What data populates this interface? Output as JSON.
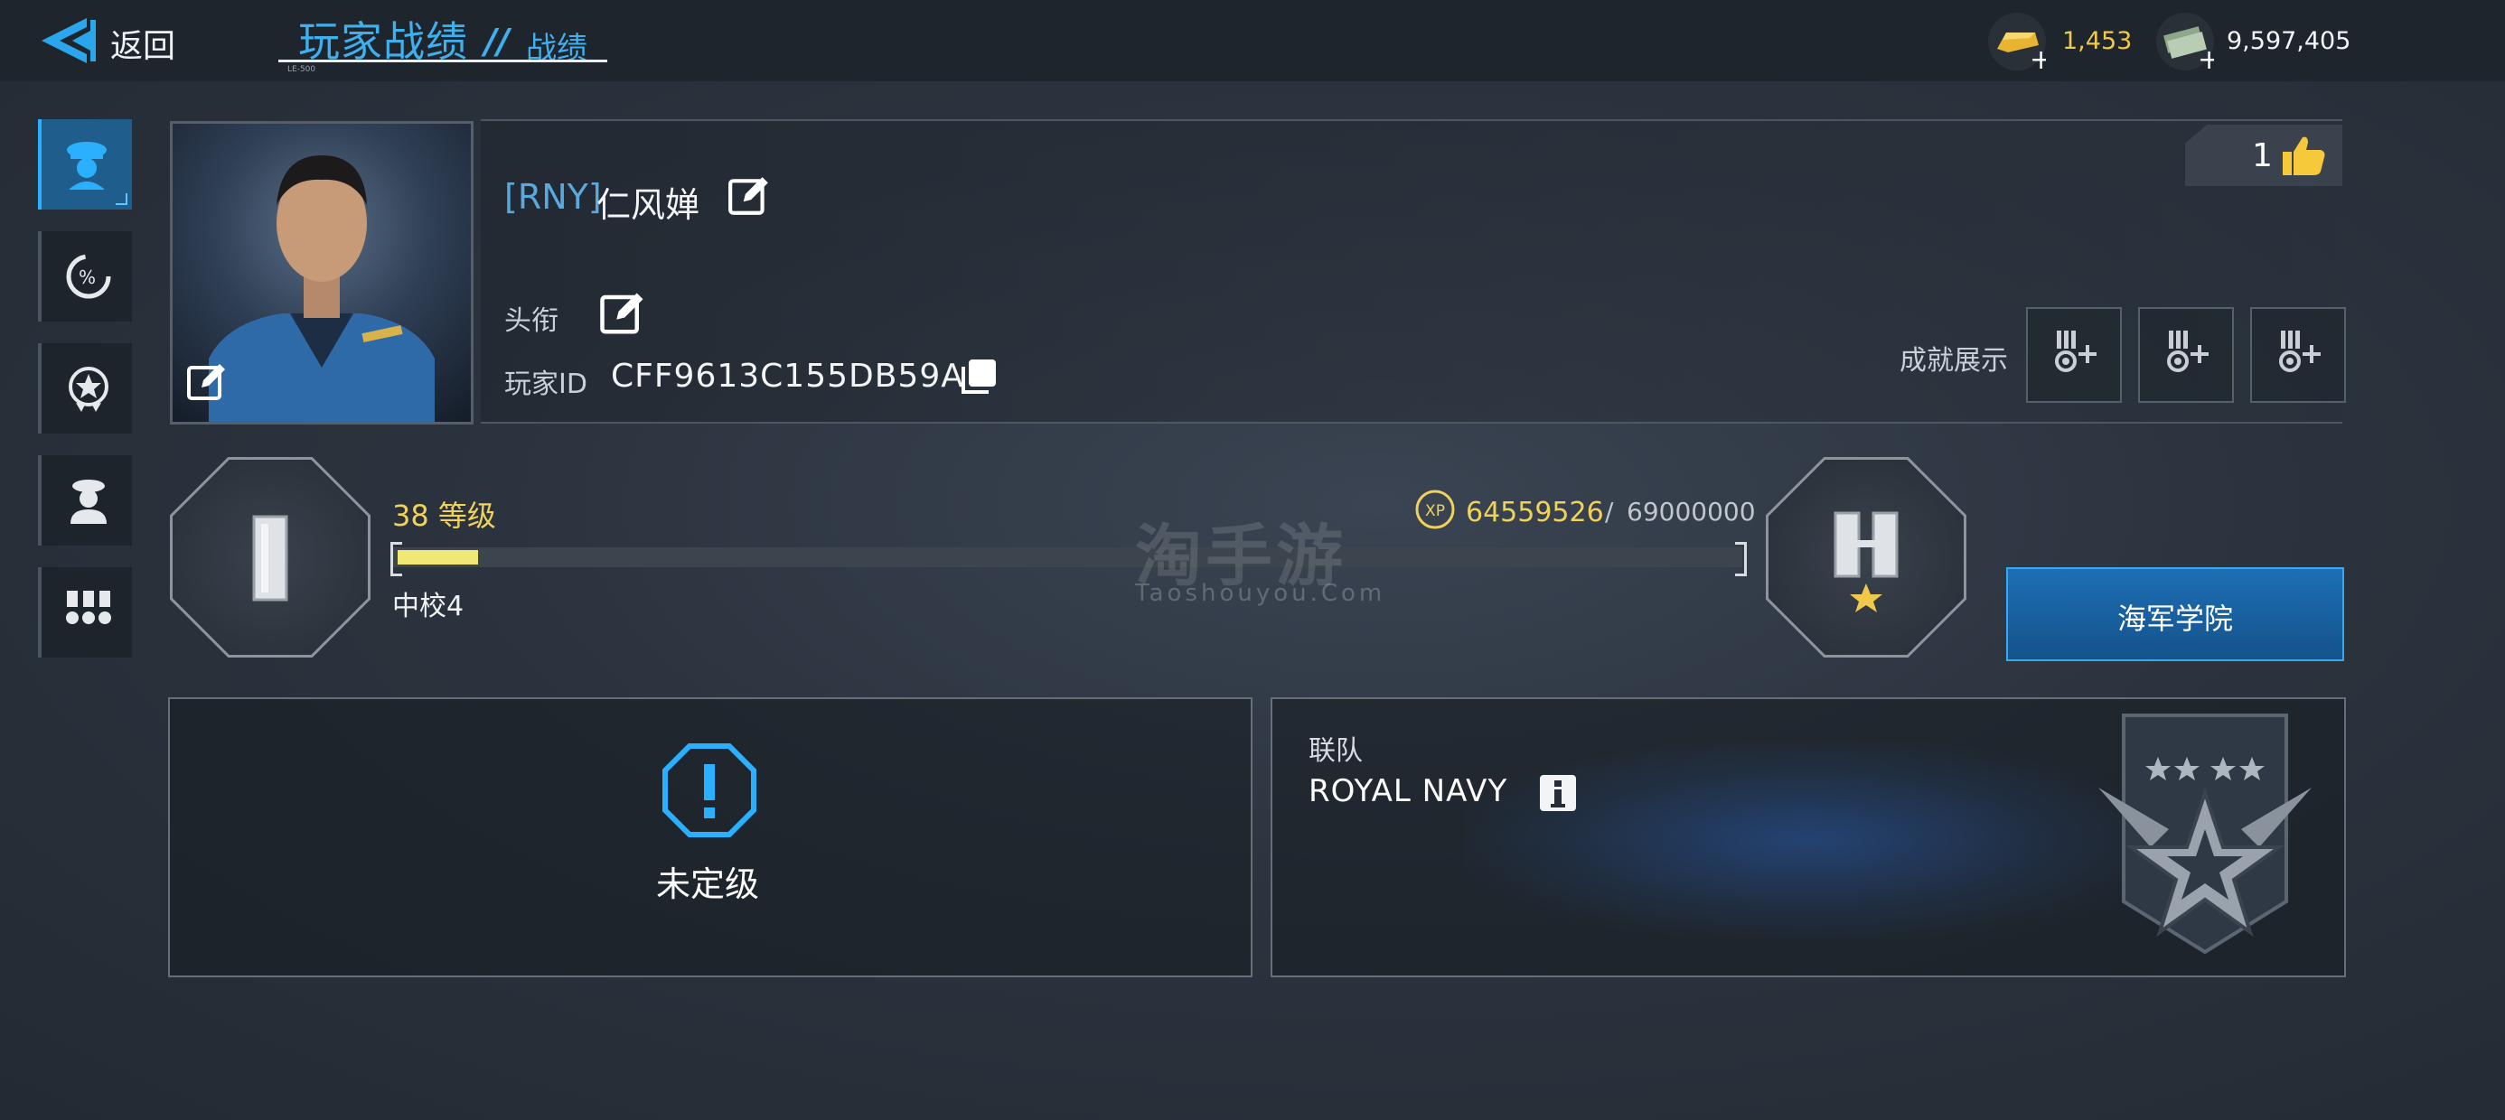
{
  "header": {
    "back_label": "返回",
    "title": "玩家战绩",
    "title_slash": "//",
    "subtitle": "战绩",
    "title_tiny": "LE-500"
  },
  "currency": {
    "gold": {
      "icon": "gold-bar-icon",
      "value": "1,453",
      "color": "#f0c84a"
    },
    "cash": {
      "icon": "cash-stack-icon",
      "value": "9,597,405",
      "color": "#f2f4f6"
    }
  },
  "sidebar": {
    "items": [
      {
        "icon": "officer-cap-icon",
        "active": true
      },
      {
        "icon": "percent-gauge-icon",
        "active": false
      },
      {
        "icon": "star-badge-icon",
        "active": false
      },
      {
        "icon": "crew-member-icon",
        "active": false
      },
      {
        "icon": "medals-icon",
        "active": false
      }
    ]
  },
  "profile": {
    "clan_tag": "[RNY]",
    "name": "仁风婵",
    "title_label": "头衔",
    "id_label": "玩家ID",
    "id_value": "CFF9613C155DB59A",
    "likes": "1",
    "achievement_label": "成就展示",
    "medal_slots": 3
  },
  "progress": {
    "level_text": "38 等级",
    "rank_text": "中校4",
    "xp_current": "64559526",
    "xp_separator": "/",
    "xp_max": "69000000",
    "xp_badge": "XP",
    "bar_fill_fraction": 0.06
  },
  "watermark": {
    "cn": "淘手游",
    "en": "Taoshouyou.Com"
  },
  "academy_button": "海军学院",
  "ranked": {
    "status": "未定级"
  },
  "alliance": {
    "label": "联队",
    "name": "ROYAL NAVY"
  },
  "colors": {
    "accent": "#3fb0ee",
    "level_yellow": "#f0d25a",
    "xp_bar": "#f1e774"
  }
}
